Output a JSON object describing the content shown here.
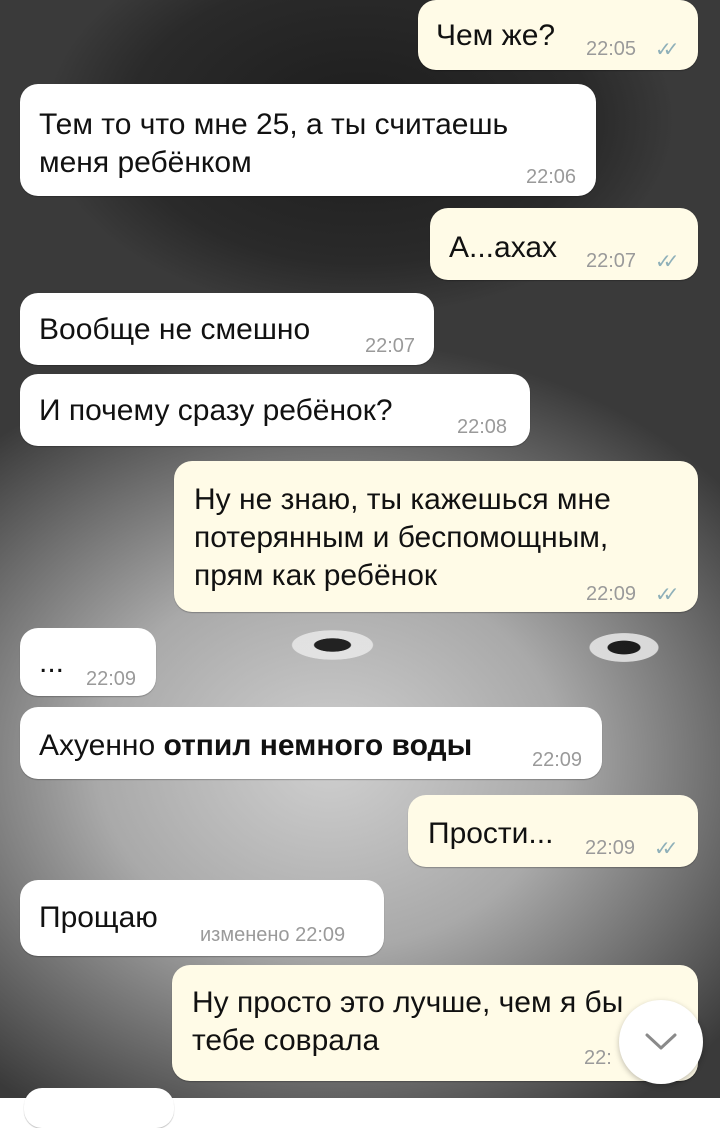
{
  "messages": [
    {
      "dir": "out",
      "text": "Чем же?",
      "time": "22:05",
      "ticks": "✓✓"
    },
    {
      "dir": "in",
      "text": "Тем то что мне 25, а ты считаешь\nменя ребёнком",
      "time": "22:06"
    },
    {
      "dir": "out",
      "text": "А...ахах",
      "time": "22:07",
      "ticks": "✓✓"
    },
    {
      "dir": "in",
      "text": "Вообще не смешно",
      "time": "22:07"
    },
    {
      "dir": "in",
      "text": "И почему сразу ребёнок?",
      "time": "22:08"
    },
    {
      "dir": "out",
      "text": "Ну не знаю, ты кажешься мне\nпотерянным и беспомощным,\nпрям как ребёнок",
      "time": "22:09",
      "ticks": "✓✓"
    },
    {
      "dir": "in",
      "text": "...",
      "time": "22:09"
    },
    {
      "dir": "in",
      "text_plain": "Ахуенно ",
      "text_bold": "отпил немного воды",
      "time": "22:09"
    },
    {
      "dir": "out",
      "text": "Прости...",
      "time": "22:09",
      "ticks": "✓✓"
    },
    {
      "dir": "in",
      "text": "Прощаю",
      "time": "изменено 22:09"
    },
    {
      "dir": "out",
      "text": "Ну просто это лучше, чем я бы\nтебе соврала",
      "time": "22:"
    }
  ],
  "scroll_button": {
    "icon": "chevron-down-icon"
  },
  "colors": {
    "incoming": "#ffffff",
    "outgoing": "#fffbe7",
    "time": "#9a9a9a",
    "ticks": "#8fb0b9"
  }
}
